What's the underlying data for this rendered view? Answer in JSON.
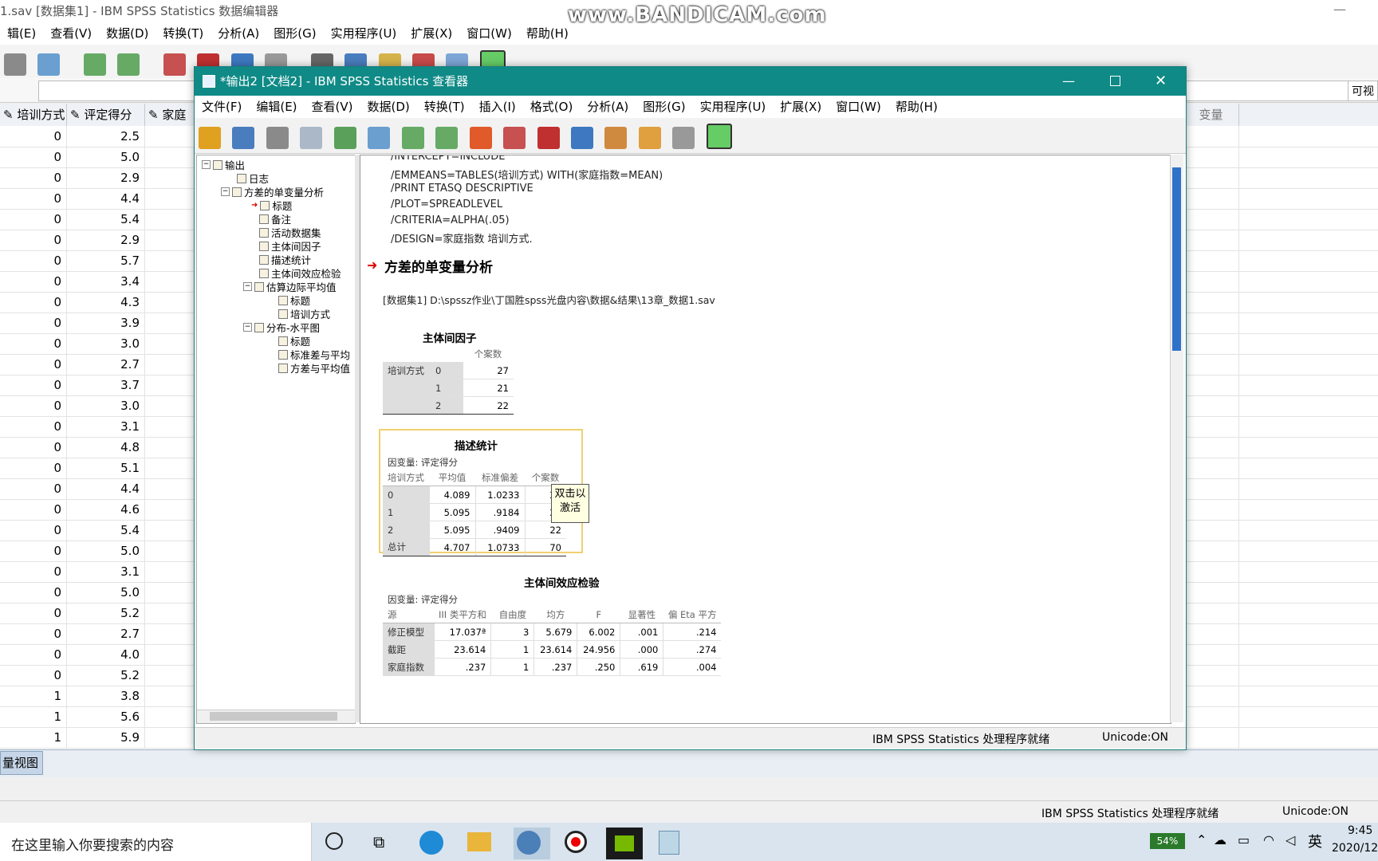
{
  "watermark": "www.BANDICAM.com",
  "editor": {
    "title": "1.sav [数据集1] - IBM SPSS Statistics 数据编辑器",
    "menu": [
      "辑(E)",
      "查看(V)",
      "数据(D)",
      "转换(T)",
      "分析(A)",
      "图形(G)",
      "实用程序(U)",
      "扩展(X)",
      "窗口(W)",
      "帮助(H)"
    ],
    "visible_label": "可视",
    "columns": [
      "培训方式",
      "评定得分",
      "家庭",
      "变量"
    ],
    "rows": [
      [
        "0",
        "2.5"
      ],
      [
        "0",
        "5.0"
      ],
      [
        "0",
        "2.9"
      ],
      [
        "0",
        "4.4"
      ],
      [
        "0",
        "5.4"
      ],
      [
        "0",
        "2.9"
      ],
      [
        "0",
        "5.7"
      ],
      [
        "0",
        "3.4"
      ],
      [
        "0",
        "4.3"
      ],
      [
        "0",
        "3.9"
      ],
      [
        "0",
        "3.0"
      ],
      [
        "0",
        "2.7"
      ],
      [
        "0",
        "3.7"
      ],
      [
        "0",
        "3.0"
      ],
      [
        "0",
        "3.1"
      ],
      [
        "0",
        "4.8"
      ],
      [
        "0",
        "5.1"
      ],
      [
        "0",
        "4.4"
      ],
      [
        "0",
        "4.6"
      ],
      [
        "0",
        "5.4"
      ],
      [
        "0",
        "5.0"
      ],
      [
        "0",
        "3.1"
      ],
      [
        "0",
        "5.0"
      ],
      [
        "0",
        "5.2"
      ],
      [
        "0",
        "2.7"
      ],
      [
        "0",
        "4.0"
      ],
      [
        "0",
        "5.2"
      ],
      [
        "1",
        "3.8"
      ],
      [
        "1",
        "5.6"
      ],
      [
        "1",
        "5.9"
      ]
    ],
    "tab_label": "量视图",
    "status": "IBM SPSS Statistics 处理程序就绪",
    "unicode": "Unicode:ON"
  },
  "viewer": {
    "title": "*输出2 [文档2] - IBM SPSS Statistics 查看器",
    "menu": [
      "文件(F)",
      "编辑(E)",
      "查看(V)",
      "数据(D)",
      "转换(T)",
      "插入(I)",
      "格式(O)",
      "分析(A)",
      "图形(G)",
      "实用程序(U)",
      "扩展(X)",
      "窗口(W)",
      "帮助(H)"
    ],
    "tree": [
      "输出",
      "日志",
      "方差的单变量分析",
      "标题",
      "备注",
      "活动数据集",
      "主体间因子",
      "描述统计",
      "主体间效应检验",
      "估算边际平均值",
      "标题",
      "培训方式",
      "分布-水平图",
      "标题",
      "标准差与平均",
      "方差与平均值"
    ],
    "syntax": [
      "/INTERCEPT=INCLUDE",
      "/EMMEANS=TABLES(培训方式) WITH(家庭指数=MEAN)",
      "/PRINT ETASQ DESCRIPTIVE",
      "/PLOT=SPREADLEVEL",
      "/CRITERIA=ALPHA(.05)",
      "/DESIGN=家庭指数 培训方式."
    ],
    "section_title": "方差的单变量分析",
    "dataset_path": "[数据集1] D:\\spssz作业\\丁国胜spss光盘内容\\数据&结果\\13章_数据1.sav",
    "factors": {
      "title": "主体间因子",
      "col": "个案数",
      "row_label": "培训方式",
      "rows": [
        [
          "0",
          "27"
        ],
        [
          "1",
          "21"
        ],
        [
          "2",
          "22"
        ]
      ]
    },
    "descriptives": {
      "title": "描述统计",
      "dv": "因变量:   评定得分",
      "headers": [
        "培训方式",
        "平均值",
        "标准偏差",
        "个案数"
      ],
      "rows": [
        [
          "0",
          "4.089",
          "1.0233",
          "27"
        ],
        [
          "1",
          "5.095",
          ".9184",
          "21"
        ],
        [
          "2",
          "5.095",
          ".9409",
          "22"
        ],
        [
          "总计",
          "4.707",
          "1.0733",
          "70"
        ]
      ],
      "tooltip": "双击以激活"
    },
    "tests": {
      "title": "主体间效应检验",
      "dv": "因变量:   评定得分",
      "headers": [
        "源",
        "III 类平方和",
        "自由度",
        "均方",
        "F",
        "显著性",
        "偏 Eta 平方"
      ],
      "rows": [
        [
          "修正模型",
          "17.037ª",
          "3",
          "5.679",
          "6.002",
          ".001",
          ".214"
        ],
        [
          "截距",
          "23.614",
          "1",
          "23.614",
          "24.956",
          ".000",
          ".274"
        ],
        [
          "家庭指数",
          ".237",
          "1",
          ".237",
          ".250",
          ".619",
          ".004"
        ]
      ]
    },
    "status": "IBM SPSS Statistics 处理程序就绪",
    "unicode": "Unicode:ON"
  },
  "taskbar": {
    "search_placeholder": "在这里输入你要搜索的内容",
    "battery": "54%",
    "ime": "英",
    "time": "9:45",
    "date": "2020/12"
  }
}
